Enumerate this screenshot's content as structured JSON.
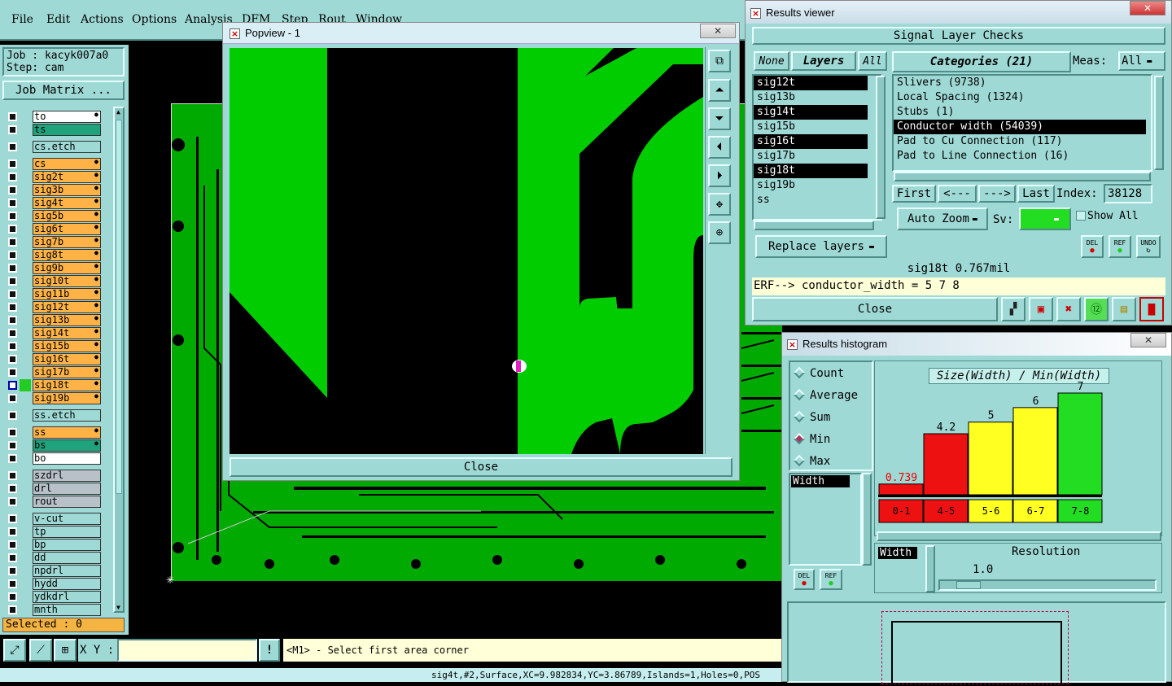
{
  "menu": {
    "items": [
      "File",
      "Edit",
      "Actions",
      "Options",
      "Analysis",
      "DFM",
      "Step",
      "Rout",
      "Window"
    ]
  },
  "job": {
    "job_label": "Job : kacyk007a0",
    "step_label": "Step: cam",
    "matrix_button": "Job Matrix ..."
  },
  "layers": [
    {
      "name": "to",
      "color": "#ffffff"
    },
    {
      "name": "ts",
      "color": "#1fa37c"
    },
    {
      "name": "cs.etch",
      "color": "#9fd9d5"
    },
    {
      "name": "cs",
      "color": "#ffb347"
    },
    {
      "name": "sig2t",
      "color": "#ffb347"
    },
    {
      "name": "sig3b",
      "color": "#ffb347"
    },
    {
      "name": "sig4t",
      "color": "#ffb347"
    },
    {
      "name": "sig5b",
      "color": "#ffb347"
    },
    {
      "name": "sig6t",
      "color": "#ffb347"
    },
    {
      "name": "sig7b",
      "color": "#ffb347"
    },
    {
      "name": "sig8t",
      "color": "#ffb347"
    },
    {
      "name": "sig9b",
      "color": "#ffb347"
    },
    {
      "name": "sig10t",
      "color": "#ffb347"
    },
    {
      "name": "sig11b",
      "color": "#ffb347"
    },
    {
      "name": "sig12t",
      "color": "#ffb347"
    },
    {
      "name": "sig13b",
      "color": "#ffb347"
    },
    {
      "name": "sig14t",
      "color": "#ffb347"
    },
    {
      "name": "sig15b",
      "color": "#ffb347"
    },
    {
      "name": "sig16t",
      "color": "#ffb347"
    },
    {
      "name": "sig17b",
      "color": "#ffb347"
    },
    {
      "name": "sig18t",
      "color": "#ffb347"
    },
    {
      "name": "sig19b",
      "color": "#ffb347"
    },
    {
      "name": "ss.etch",
      "color": "#9fd9d5"
    },
    {
      "name": "ss",
      "color": "#ffb347"
    },
    {
      "name": "bs",
      "color": "#1fa37c"
    },
    {
      "name": "bo",
      "color": "#ffffff"
    },
    {
      "name": "szdrl",
      "color": "#b8c0c8"
    },
    {
      "name": "drl",
      "color": "#b8c0c8"
    },
    {
      "name": "rout",
      "color": "#b8c0c8"
    },
    {
      "name": "v-cut",
      "color": "#9fd9d5"
    },
    {
      "name": "tp",
      "color": "#9fd9d5"
    },
    {
      "name": "bp",
      "color": "#9fd9d5"
    },
    {
      "name": "dd",
      "color": "#9fd9d5"
    },
    {
      "name": "npdrl",
      "color": "#9fd9d5"
    },
    {
      "name": "hydd",
      "color": "#9fd9d5"
    },
    {
      "name": "ydkdrl",
      "color": "#9fd9d5"
    },
    {
      "name": "mnth",
      "color": "#9fd9d5"
    }
  ],
  "selected_label": "Selected : 0",
  "popview": {
    "title": "Popview - 1",
    "close_label": "Close"
  },
  "bottom": {
    "xy_label": "X Y :",
    "xy_value": "",
    "prompt": "<M1> - Select first area corner",
    "status": "sig4t,#2,Surface,XC=9.982834,YC=3.86789,Islands=1,Holes=0,POS"
  },
  "results_viewer": {
    "title": "Results viewer",
    "header": "Signal Layer Checks",
    "tab_none": "None",
    "tab_layers": "Layers",
    "tab_all": "All",
    "categories_label": "Categories (21)",
    "meas_label": "Meas:",
    "meas_value": "All",
    "layers": [
      "sig12t",
      "sig13b",
      "sig14t",
      "sig15b",
      "sig16t",
      "sig17b",
      "sig18t",
      "sig19b",
      "ss"
    ],
    "selected_layers": [
      "sig12t",
      "sig14t",
      "sig16t",
      "sig18t"
    ],
    "categories": [
      "Slivers (9738)",
      "Local Spacing (1324)",
      "Stubs (1)",
      "Conductor width (54039)",
      "Pad to Cu Connection (117)",
      "Pad to Line Connection (16)"
    ],
    "selected_category": "Conductor width (54039)",
    "first": "First",
    "prev": "<---",
    "next": "--->",
    "last": "Last",
    "index_label": "Index:",
    "index_value": "38128",
    "auto_zoom": "Auto Zoom",
    "sv_label": "Sv:",
    "show_all": "Show All",
    "replace_layers": "Replace layers",
    "del": "DEL",
    "ref": "REF",
    "undo": "UNDO",
    "status": "sig18t 0.767mil",
    "erf": "ERF--> conductor_width = 5 7 8",
    "close": "Close"
  },
  "histogram": {
    "title": "Results histogram",
    "options": [
      "Count",
      "Average",
      "Sum",
      "Min",
      "Max"
    ],
    "selected_option": "Min",
    "field_label": "Width",
    "del": "DEL",
    "ref": "REF",
    "resolution_label": "Resolution",
    "resolution_value": "1.0",
    "width_label": "Width"
  },
  "chart_data": {
    "type": "bar",
    "title": "Size(Width) / Min(Width)",
    "categories": [
      "0-1",
      "4-5",
      "5-6",
      "6-7",
      "7-8"
    ],
    "values": [
      0.739,
      4.2,
      5,
      6,
      7
    ],
    "labels": [
      "0.739",
      "4.2",
      "5",
      "6",
      "7"
    ],
    "colors": [
      "#ee1111",
      "#ee1111",
      "#ffff22",
      "#ffff22",
      "#22dd22"
    ]
  }
}
